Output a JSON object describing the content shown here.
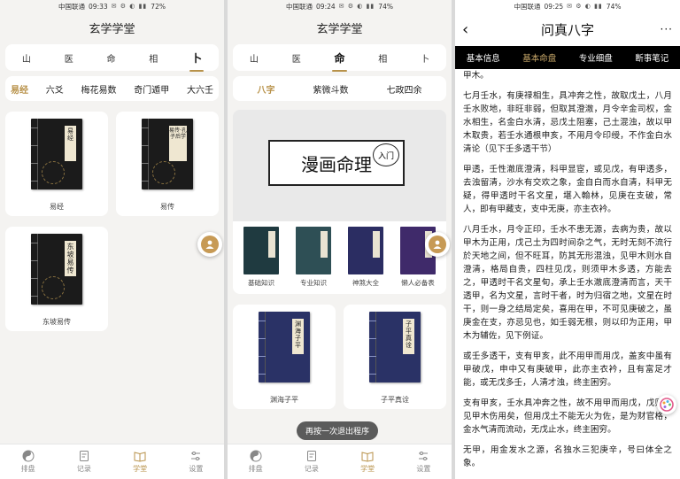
{
  "screen1": {
    "status": {
      "carrier": "中国联通",
      "time": "09:33",
      "battery": "72%"
    },
    "title": "玄学学堂",
    "categories": [
      {
        "label": "山",
        "active": false
      },
      {
        "label": "医",
        "active": false
      },
      {
        "label": "命",
        "active": false
      },
      {
        "label": "相",
        "active": false
      },
      {
        "label": "卜",
        "active": true
      }
    ],
    "subtabs": [
      {
        "label": "易经",
        "active": true
      },
      {
        "label": "六爻",
        "active": false
      },
      {
        "label": "梅花易数",
        "active": false
      },
      {
        "label": "奇门遁甲",
        "active": false
      },
      {
        "label": "大六壬",
        "active": false
      }
    ],
    "books": [
      {
        "name": "易经",
        "cover_title": "易经"
      },
      {
        "name": "易传",
        "cover_title": "易传·孔子后学"
      },
      {
        "name": "东坡易传",
        "cover_title": "东坡易传"
      }
    ]
  },
  "screen2": {
    "status": {
      "carrier": "中国联通",
      "time": "09:24",
      "battery": "74%"
    },
    "title": "玄学学堂",
    "categories": [
      {
        "label": "山",
        "active": false
      },
      {
        "label": "医",
        "active": false
      },
      {
        "label": "命",
        "active": true
      },
      {
        "label": "相",
        "active": false
      },
      {
        "label": "卜",
        "active": false
      }
    ],
    "subtabs": [
      {
        "label": "八字",
        "active": true
      },
      {
        "label": "紫微斗数",
        "active": false
      },
      {
        "label": "七政四余",
        "active": false
      }
    ],
    "banner": {
      "title": "漫画命理",
      "seal": "入门"
    },
    "knowledge": [
      {
        "name": "基础知识",
        "color": "#1f3a40"
      },
      {
        "name": "专业知识",
        "color": "#2e4f55"
      },
      {
        "name": "神煞大全",
        "color": "#2b2d62"
      },
      {
        "name": "懒人必备表",
        "color": "#3f2a6a"
      }
    ],
    "books": [
      {
        "name": "渊海子平",
        "cover_title": "渊海子平"
      },
      {
        "name": "子平真诠",
        "cover_title": "子平真诠"
      }
    ],
    "toast": "再按一次退出程序"
  },
  "screen3": {
    "status": {
      "carrier": "中国联通",
      "time": "09:25",
      "battery": "74%"
    },
    "title": "问真八字",
    "tabs": [
      {
        "label": "基本信息",
        "active": false
      },
      {
        "label": "基本命盘",
        "active": true
      },
      {
        "label": "专业细盘",
        "active": false
      },
      {
        "label": "断事笔记",
        "active": false
      }
    ],
    "paragraphs": [
      "甲木。",
      "七月壬水，有庚禄相生，具冲奔之性，故取戊土，八月壬水败地，非旺非弱，但取其澄澈，月令辛金司权，金水相生，名金白水清，忌戊土阻塞，己土混浊，故以甲木取贵，若壬水通根申亥，不用月令印绶，不作金白水清论（见下壬多透干节）",
      "甲透，壬性澈底澄清，科甲显宦，或见戊，有甲透多，去浊留清，沙水有交欢之象，金自白而水自清，科甲无疑，得甲透时干名文星，堪入翰林，见庚在支破，常人，即有甲藏支，支中无庚，亦主衣衿。",
      "八月壬水，月令正印，壬水不患无源，去病为贵，故以甲木为正用，戊己土为四时间杂之气，无时无刻不流行於天地之间，但不旺耳，防其无形混浊，见甲木则水自澄清，格局自贵，四柱见戊，则须甲木多透，方能去之，甲透时干名文星旬，承上壬水澈底澄清而言，天干透甲，名为文星，言时干者，时为归宿之地，文星在时干，则一身之结局定矣，喜用在甲，不可见庚破之，虽庚金在支，亦忌见也，如壬弱无根，则以印为正用，甲木为辅佐，见下例证。",
      "或壬多透干，支有甲亥，此不用甲而用戊，盖亥中虽有甲破戊，申中又有庚破甲，此亦主衣衿，且有富足才能，或无戊多壬，人清才浊，终主困穷。",
      "支有甲亥，壬水具冲奔之性，故不用甲而用戊，戊则忌见甲木伤用矣，但用戊土不能无火为佐，是为财官格，金水气清而流动，无戊止水，终主困穷。",
      "无甲，用金发水之源，名独水三犯庚辛，号曰体全之象。"
    ]
  },
  "bottom_nav": [
    {
      "label": "排盘",
      "icon": "yin-yang-icon",
      "active": false
    },
    {
      "label": "记录",
      "icon": "record-icon",
      "active": false
    },
    {
      "label": "学堂",
      "icon": "book-icon",
      "active": true
    },
    {
      "label": "设置",
      "icon": "settings-icon",
      "active": false
    }
  ],
  "colors": {
    "accent": "#b8924a",
    "book_black": "#1b1b1b",
    "book_blue": "#2a3266"
  }
}
